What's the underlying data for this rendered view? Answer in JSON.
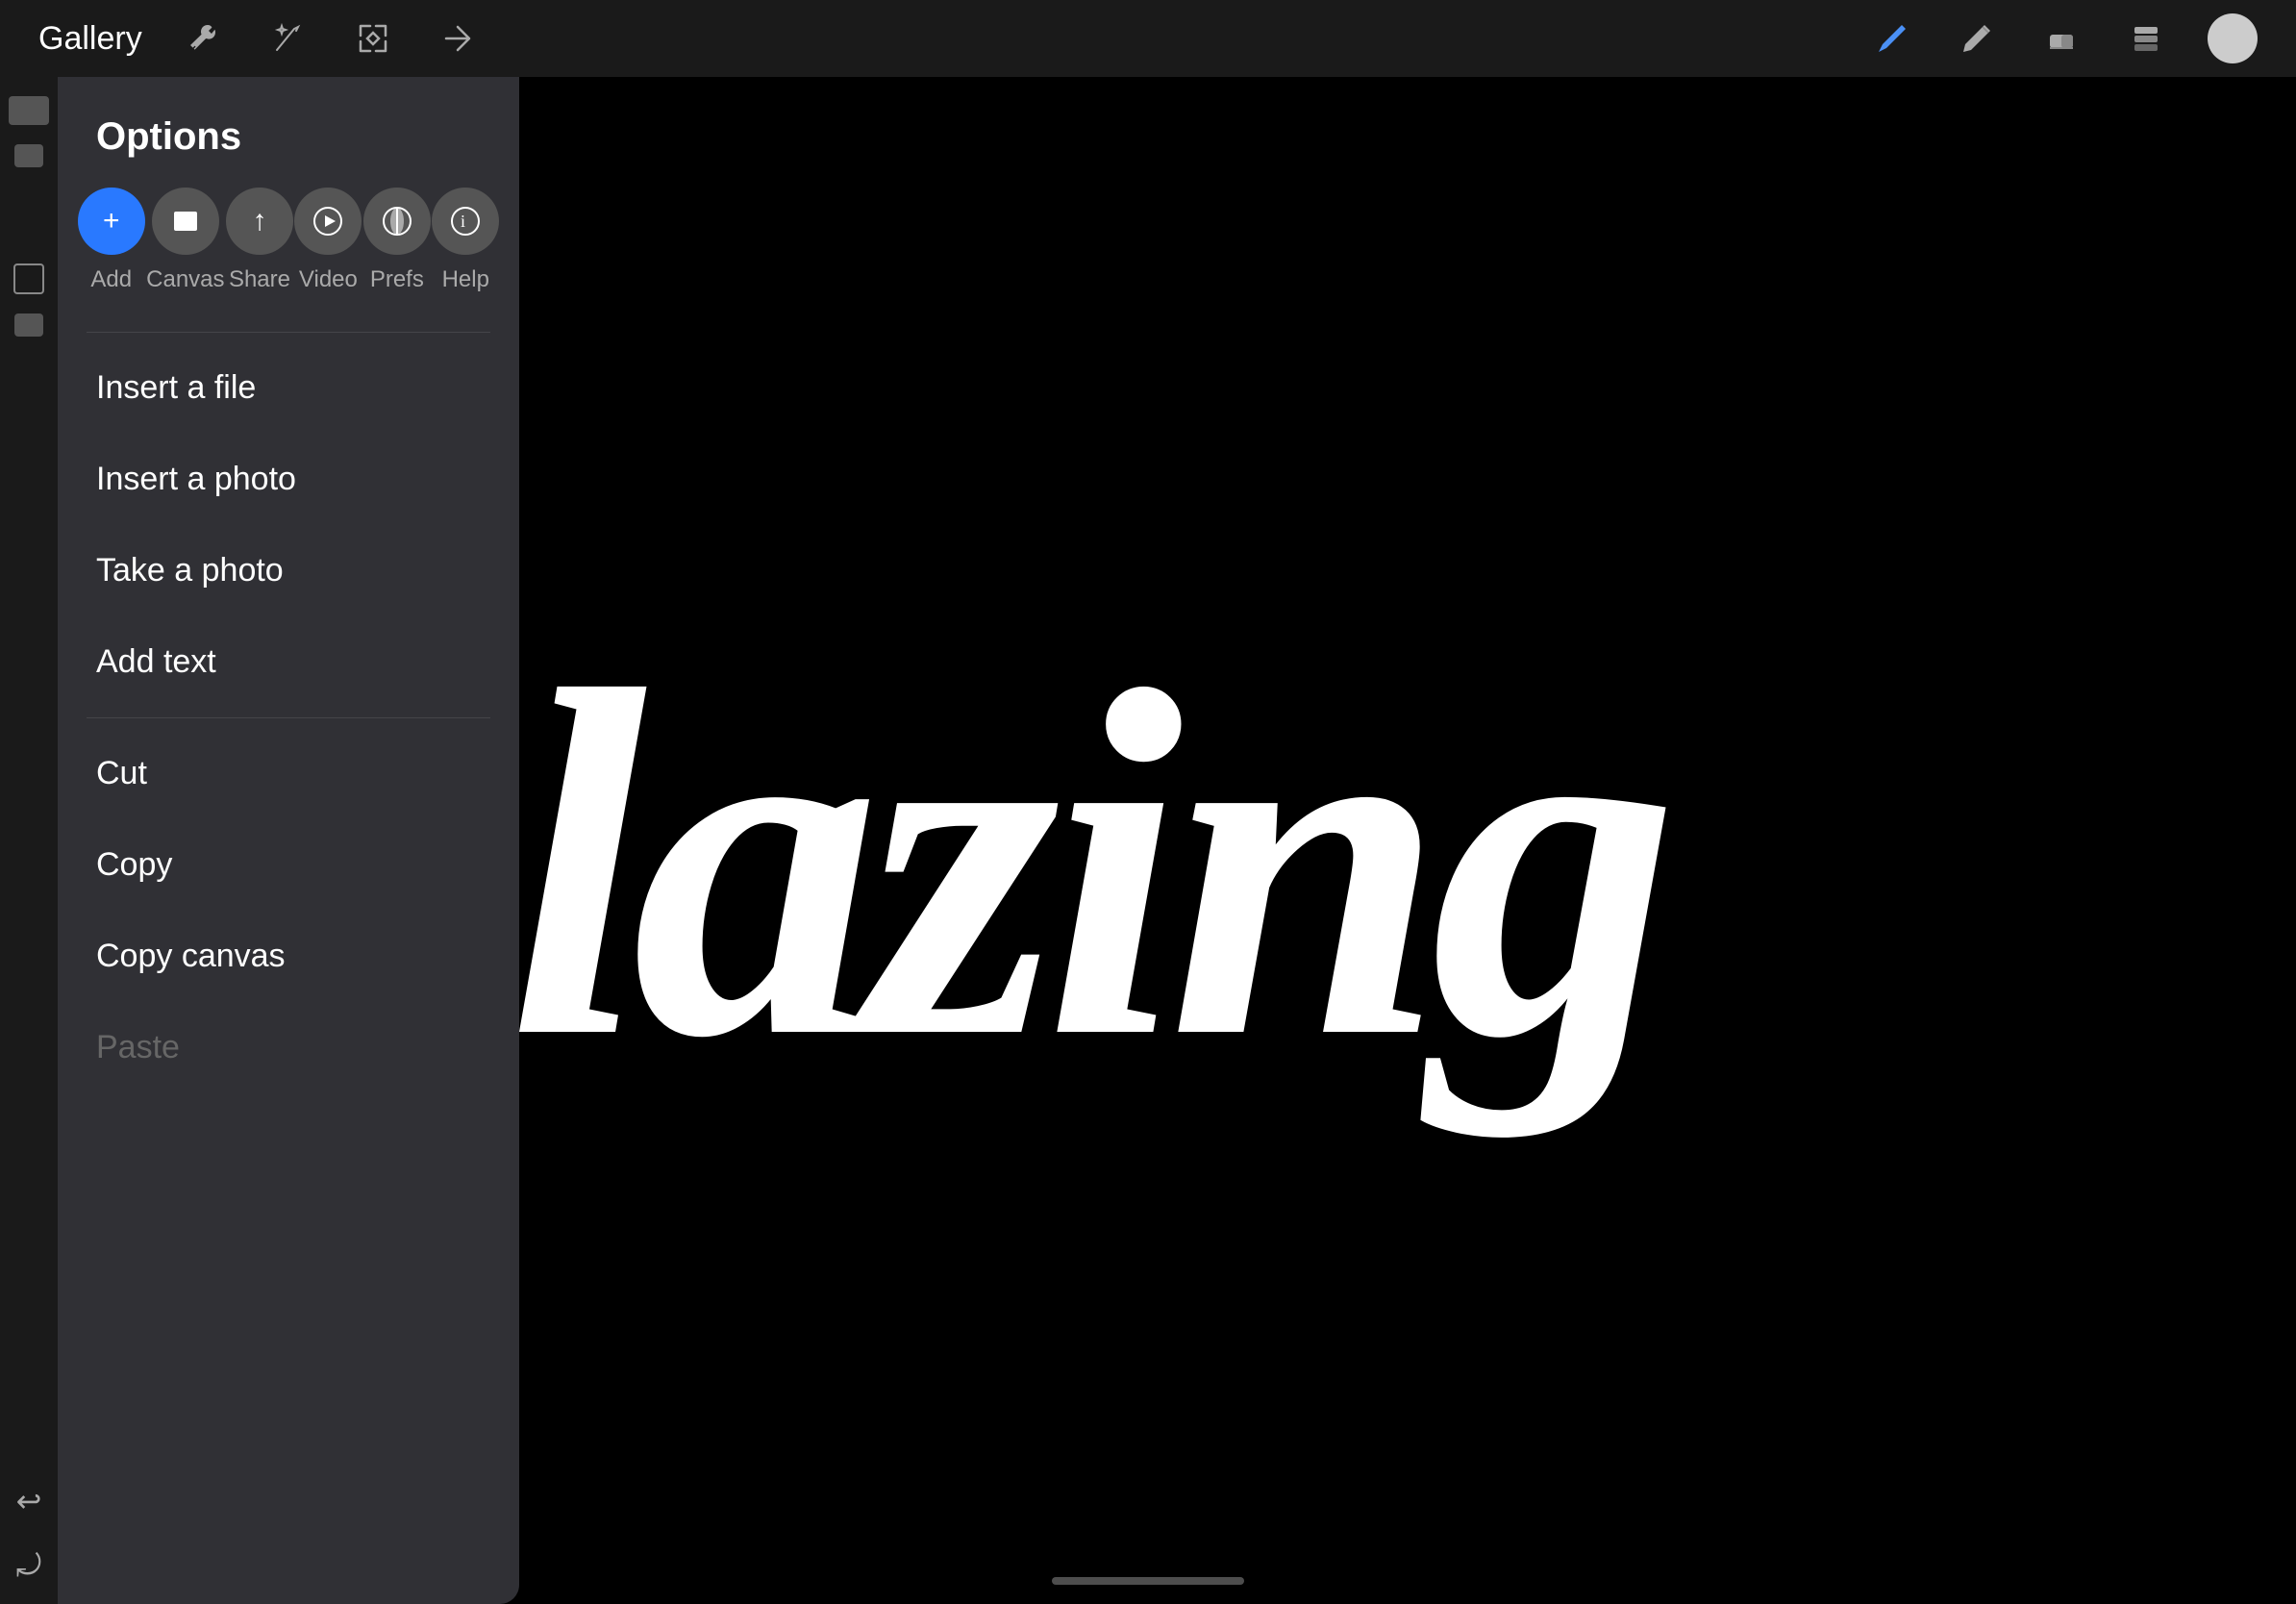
{
  "toolbar": {
    "gallery_label": "Gallery",
    "icons": [
      {
        "name": "wrench-icon",
        "label": "wrench"
      },
      {
        "name": "magic-icon",
        "label": "magic"
      },
      {
        "name": "selection-icon",
        "label": "selection"
      },
      {
        "name": "transform-icon",
        "label": "transform"
      }
    ],
    "right_icons": [
      {
        "name": "pen-tool-icon",
        "label": "pen"
      },
      {
        "name": "pencil-icon",
        "label": "pencil"
      },
      {
        "name": "eraser-icon",
        "label": "eraser"
      },
      {
        "name": "layers-icon",
        "label": "layers"
      }
    ],
    "avatar_label": "user avatar"
  },
  "options_panel": {
    "title": "Options",
    "icons": [
      {
        "id": "add",
        "label": "Add",
        "symbol": "+",
        "style": "blue"
      },
      {
        "id": "canvas",
        "label": "Canvas",
        "symbol": "⬛"
      },
      {
        "id": "share",
        "label": "Share",
        "symbol": "↑"
      },
      {
        "id": "video",
        "label": "Video",
        "symbol": "▶"
      },
      {
        "id": "prefs",
        "label": "Prefs",
        "symbol": "◑"
      },
      {
        "id": "help",
        "label": "Help",
        "symbol": "ⓘ"
      }
    ],
    "menu_items": [
      {
        "id": "insert-file",
        "label": "Insert a file",
        "disabled": false
      },
      {
        "id": "insert-photo",
        "label": "Insert a photo",
        "disabled": false
      },
      {
        "id": "take-photo",
        "label": "Take a photo",
        "disabled": false
      },
      {
        "id": "add-text",
        "label": "Add text",
        "disabled": false
      },
      {
        "id": "cut",
        "label": "Cut",
        "disabled": false
      },
      {
        "id": "copy",
        "label": "Copy",
        "disabled": false
      },
      {
        "id": "copy-canvas",
        "label": "Copy canvas",
        "disabled": false
      },
      {
        "id": "paste",
        "label": "Paste",
        "disabled": true
      }
    ]
  },
  "canvas": {
    "artwork_text": "lazing"
  },
  "colors": {
    "background": "#000000",
    "toolbar_bg": "#1a1a1a",
    "panel_bg": "rgba(50,50,55,0.96)",
    "blue_accent": "#2979ff",
    "pen_blue": "#4a90f5"
  }
}
